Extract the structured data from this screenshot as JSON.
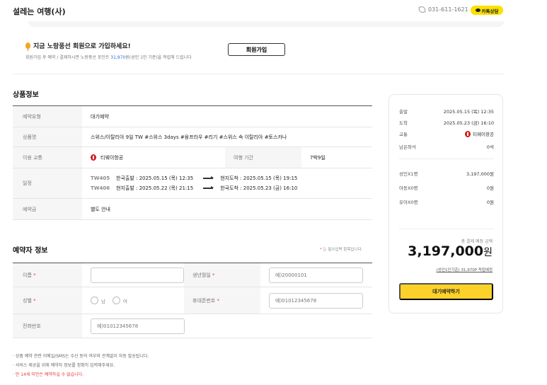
{
  "header": {
    "brand": "설레는 여행(사)",
    "phone": "031-611-1621",
    "kakao_label": "카톡상담"
  },
  "promo": {
    "title": "지금 노랑풍선 회원으로 가입하세요!",
    "desc_before": "회원가입 후 예약 / 결제하시면 노랑풍선 포인트 ",
    "desc_point": "31,970",
    "desc_after": "원(성인 1인 기준)을 적립해 드립니다",
    "join_label": "회원가입"
  },
  "product": {
    "section_title": "상품정보",
    "rows": {
      "type_label": "예약유형",
      "type_value": "대기예약",
      "name_label": "상품명",
      "name_value": "스위스/이탈리아 9일 TW #스위스 3days #융프라우 #리기 #스위스 속 이탈리아 #토스카나",
      "transport_label": "이용 교통",
      "transport_value": "티웨이항공",
      "period_label": "여행 기간",
      "period_value": "7박9일",
      "schedule_label": "일정",
      "deposit_label": "예약금",
      "deposit_value": "별도 안내"
    },
    "schedule": [
      {
        "code": "TW405",
        "depart": "한국출발 : 2025.05.15 (목) 12:35",
        "arrive": "현지도착 : 2025.05.15 (목) 19:15"
      },
      {
        "code": "TW406",
        "depart": "현지출발 : 2025.05.22 (목) 21:15",
        "arrive": "한국도착 : 2025.05.23 (금) 16:10"
      }
    ]
  },
  "booker": {
    "section_title": "예약자 정보",
    "required_note": "는 필수입력 항목입니다.",
    "name_label": "이름",
    "birth_label": "생년월일",
    "birth_placeholder": "예)20000101",
    "gender_label": "성별",
    "male": "남",
    "female": "여",
    "mobile_label": "휴대폰번호",
    "mobile_placeholder": "예)01012345678",
    "tel_label": "전화번호",
    "tel_placeholder": "예)01012345678"
  },
  "notes": [
    "· 상품 예약 관련 이메일/SMS는 수신 동의 여부와 관계없이 자동 발송됩니다.",
    "· 서비스 제공을 위해 예약자 정보를 정확히 입력해주세요."
  ],
  "warning": "· 만 14세 미만은 예약하실 수 없습니다.",
  "summary": {
    "depart_k": "출발",
    "depart_v": "2025.05.15 (목) 12:35",
    "arrive_k": "도착",
    "arrive_v": "2025.05.23 (금) 16:10",
    "transport_k": "교통",
    "transport_v": "티웨이항공",
    "seats_k": "남은좌석",
    "seats_v": "0석",
    "adult_k": "성인X1명",
    "adult_v": "3,197,000원",
    "child_k": "아동X0명",
    "child_v": "0원",
    "infant_k": "유아X0명",
    "infant_v": "0원",
    "total_label": "총 결제 예정 금액",
    "total_amount": "3,197,000",
    "total_unit": "원",
    "point_note": "(성인1인기준) 31,970P 적립예정",
    "reserve_label": "대기예약하기"
  }
}
